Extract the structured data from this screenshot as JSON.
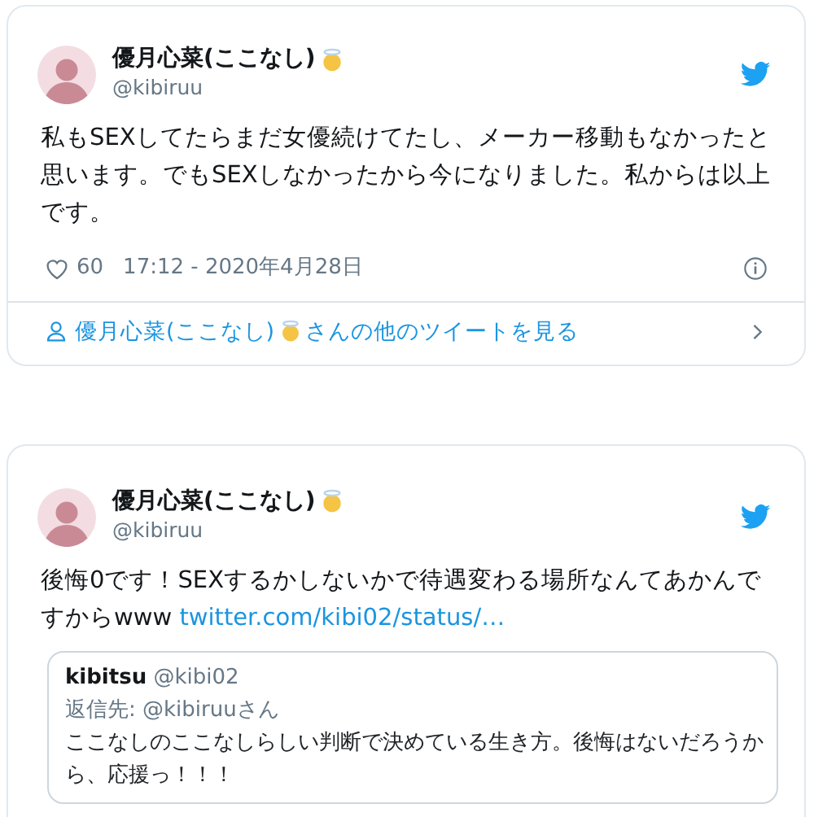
{
  "tweets": [
    {
      "author": {
        "name": "優月心菜(ここなし)",
        "handle": "@kibiruu"
      },
      "text": "私もSEXしてたらまだ女優続けてたし、メーカー移動もなかったと思います。でもSEXしなかったから今になりました。私からは以上です。",
      "likes": "60",
      "timestamp": "17:12 - 2020年4月28日",
      "more_link": {
        "before": "優月心菜(ここなし)",
        "after": "さんの他のツイートを見る"
      }
    },
    {
      "author": {
        "name": "優月心菜(ここなし)",
        "handle": "@kibiruu"
      },
      "text": "後悔0です！SEXするかしないかで待遇変わる場所なんてあかんですからwww",
      "link": "twitter.com/kibi02/status/…",
      "quote": {
        "name": "kibitsu",
        "handle": "@kibi02",
        "reply_to": "返信先: @kibiruuさん",
        "text": "ここなしのここなしらしい判断で決めている生き方。後悔はないだろうから、応援っ！！！"
      }
    }
  ]
}
